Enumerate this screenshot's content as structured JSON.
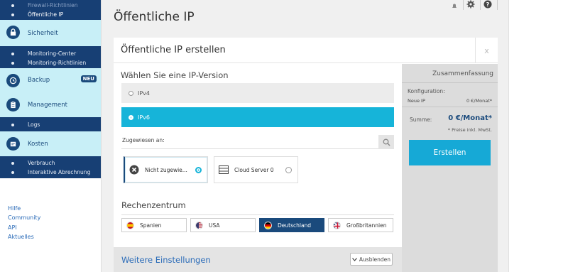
{
  "sidebar": {
    "firewall_sub": [
      "Firewall-Richtlinien",
      "Öffentliche IP"
    ],
    "sections": [
      {
        "label": "Sicherheit",
        "icon": "lock-icon",
        "sub": [
          "Monitoring-Center",
          "Monitoring-Richtlinien"
        ]
      },
      {
        "label": "Backup",
        "icon": "clock-icon",
        "badge": "NEU",
        "sub": []
      },
      {
        "label": "Management",
        "icon": "clipboard-icon",
        "sub": [
          "Logs"
        ]
      },
      {
        "label": "Kosten",
        "icon": "cost-icon",
        "sub": [
          "Verbrauch",
          "Interaktive Abrechnung"
        ]
      }
    ],
    "footer_links": [
      "Hilfe",
      "Community",
      "API",
      "Aktuelles"
    ]
  },
  "page_title": "Öffentliche IP",
  "dialog": {
    "title": "Öffentliche IP erstellen",
    "close": "x",
    "version_heading": "Wählen Sie eine IP-Version",
    "options": [
      "IPv4",
      "IPv6"
    ],
    "selected_option": "IPv6",
    "assigned_label": "Zugewiesen an:",
    "cards": [
      {
        "label": "Nicht zugewie...",
        "selected": true
      },
      {
        "label": "Cloud Server 0",
        "selected": false
      }
    ],
    "dc_heading": "Rechenzentrum",
    "datacenters": [
      {
        "label": "Spanien",
        "flag": "es-flag"
      },
      {
        "label": "USA",
        "flag": "us-flag"
      },
      {
        "label": "Deutschland",
        "flag": "de-flag",
        "selected": true
      },
      {
        "label": "Großbritannien",
        "flag": "gb-flag"
      }
    ],
    "more_settings": "Weitere Einstellungen",
    "hide_button": "Ausblenden"
  },
  "summary": {
    "title": "Zusammenfassung",
    "config_label": "Konfiguration:",
    "item": "Neue IP",
    "item_price": "0 €/Monat*",
    "total_label": "Summe:",
    "total_value": "0 €/Monat*",
    "tax_note": "* Preise inkl. MwSt.",
    "create_button": "Erstellen"
  },
  "colors": {
    "nav_dark": "#173f74",
    "nav_light": "#c8eff7",
    "accent": "#16b4d9",
    "create": "#16a9d6"
  }
}
